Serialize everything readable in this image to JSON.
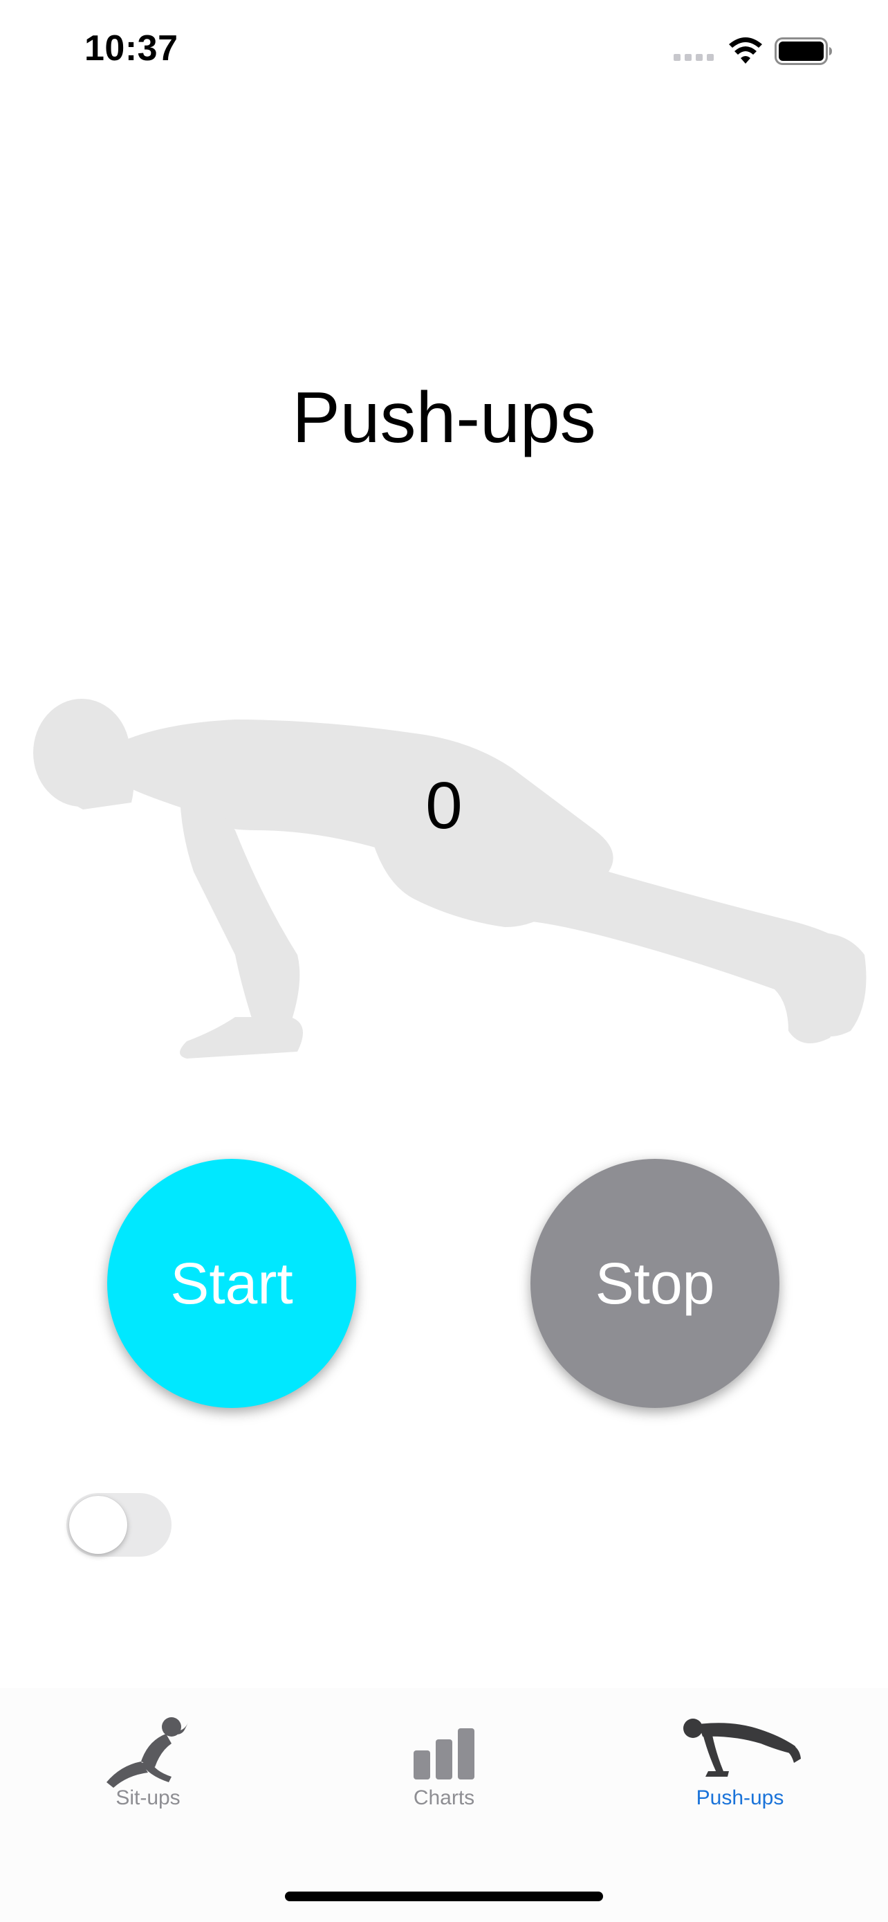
{
  "status_bar": {
    "time": "10:37",
    "icons": [
      "cellular-signal-icon",
      "wifi-icon",
      "battery-icon"
    ]
  },
  "screen": {
    "title": "Push-ups",
    "rep_count": "0",
    "start_label": "Start",
    "stop_label": "Stop",
    "toggle_on": false
  },
  "colors": {
    "start": "#00e8ff",
    "stop": "#8e8e93",
    "active_tab": "#1a73d9",
    "inactive_tab": "#8e8e93",
    "figure": "#e6e6e6"
  },
  "tab_bar": {
    "items": [
      {
        "label": "Sit-ups",
        "icon": "sit-up-figure-icon",
        "active": false
      },
      {
        "label": "Charts",
        "icon": "bar-chart-icon",
        "active": false
      },
      {
        "label": "Push-ups",
        "icon": "push-up-figure-icon",
        "active": true
      }
    ]
  }
}
